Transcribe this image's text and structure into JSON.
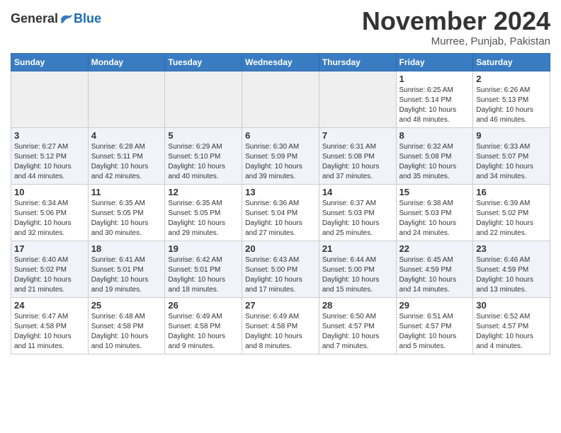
{
  "header": {
    "logo_general": "General",
    "logo_blue": "Blue",
    "month_title": "November 2024",
    "location": "Murree, Punjab, Pakistan"
  },
  "weekdays": [
    "Sunday",
    "Monday",
    "Tuesday",
    "Wednesday",
    "Thursday",
    "Friday",
    "Saturday"
  ],
  "weeks": [
    {
      "row_class": "row-1",
      "days": [
        {
          "num": "",
          "empty": true
        },
        {
          "num": "",
          "empty": true
        },
        {
          "num": "",
          "empty": true
        },
        {
          "num": "",
          "empty": true
        },
        {
          "num": "",
          "empty": true
        },
        {
          "num": "1",
          "info": "Sunrise: 6:25 AM\nSunset: 5:14 PM\nDaylight: 10 hours\nand 48 minutes."
        },
        {
          "num": "2",
          "info": "Sunrise: 6:26 AM\nSunset: 5:13 PM\nDaylight: 10 hours\nand 46 minutes."
        }
      ]
    },
    {
      "row_class": "row-2",
      "days": [
        {
          "num": "3",
          "info": "Sunrise: 6:27 AM\nSunset: 5:12 PM\nDaylight: 10 hours\nand 44 minutes."
        },
        {
          "num": "4",
          "info": "Sunrise: 6:28 AM\nSunset: 5:11 PM\nDaylight: 10 hours\nand 42 minutes."
        },
        {
          "num": "5",
          "info": "Sunrise: 6:29 AM\nSunset: 5:10 PM\nDaylight: 10 hours\nand 40 minutes."
        },
        {
          "num": "6",
          "info": "Sunrise: 6:30 AM\nSunset: 5:09 PM\nDaylight: 10 hours\nand 39 minutes."
        },
        {
          "num": "7",
          "info": "Sunrise: 6:31 AM\nSunset: 5:08 PM\nDaylight: 10 hours\nand 37 minutes."
        },
        {
          "num": "8",
          "info": "Sunrise: 6:32 AM\nSunset: 5:08 PM\nDaylight: 10 hours\nand 35 minutes."
        },
        {
          "num": "9",
          "info": "Sunrise: 6:33 AM\nSunset: 5:07 PM\nDaylight: 10 hours\nand 34 minutes."
        }
      ]
    },
    {
      "row_class": "row-3",
      "days": [
        {
          "num": "10",
          "info": "Sunrise: 6:34 AM\nSunset: 5:06 PM\nDaylight: 10 hours\nand 32 minutes."
        },
        {
          "num": "11",
          "info": "Sunrise: 6:35 AM\nSunset: 5:05 PM\nDaylight: 10 hours\nand 30 minutes."
        },
        {
          "num": "12",
          "info": "Sunrise: 6:35 AM\nSunset: 5:05 PM\nDaylight: 10 hours\nand 29 minutes."
        },
        {
          "num": "13",
          "info": "Sunrise: 6:36 AM\nSunset: 5:04 PM\nDaylight: 10 hours\nand 27 minutes."
        },
        {
          "num": "14",
          "info": "Sunrise: 6:37 AM\nSunset: 5:03 PM\nDaylight: 10 hours\nand 25 minutes."
        },
        {
          "num": "15",
          "info": "Sunrise: 6:38 AM\nSunset: 5:03 PM\nDaylight: 10 hours\nand 24 minutes."
        },
        {
          "num": "16",
          "info": "Sunrise: 6:39 AM\nSunset: 5:02 PM\nDaylight: 10 hours\nand 22 minutes."
        }
      ]
    },
    {
      "row_class": "row-4",
      "days": [
        {
          "num": "17",
          "info": "Sunrise: 6:40 AM\nSunset: 5:02 PM\nDaylight: 10 hours\nand 21 minutes."
        },
        {
          "num": "18",
          "info": "Sunrise: 6:41 AM\nSunset: 5:01 PM\nDaylight: 10 hours\nand 19 minutes."
        },
        {
          "num": "19",
          "info": "Sunrise: 6:42 AM\nSunset: 5:01 PM\nDaylight: 10 hours\nand 18 minutes."
        },
        {
          "num": "20",
          "info": "Sunrise: 6:43 AM\nSunset: 5:00 PM\nDaylight: 10 hours\nand 17 minutes."
        },
        {
          "num": "21",
          "info": "Sunrise: 6:44 AM\nSunset: 5:00 PM\nDaylight: 10 hours\nand 15 minutes."
        },
        {
          "num": "22",
          "info": "Sunrise: 6:45 AM\nSunset: 4:59 PM\nDaylight: 10 hours\nand 14 minutes."
        },
        {
          "num": "23",
          "info": "Sunrise: 6:46 AM\nSunset: 4:59 PM\nDaylight: 10 hours\nand 13 minutes."
        }
      ]
    },
    {
      "row_class": "row-5",
      "days": [
        {
          "num": "24",
          "info": "Sunrise: 6:47 AM\nSunset: 4:58 PM\nDaylight: 10 hours\nand 11 minutes."
        },
        {
          "num": "25",
          "info": "Sunrise: 6:48 AM\nSunset: 4:58 PM\nDaylight: 10 hours\nand 10 minutes."
        },
        {
          "num": "26",
          "info": "Sunrise: 6:49 AM\nSunset: 4:58 PM\nDaylight: 10 hours\nand 9 minutes."
        },
        {
          "num": "27",
          "info": "Sunrise: 6:49 AM\nSunset: 4:58 PM\nDaylight: 10 hours\nand 8 minutes."
        },
        {
          "num": "28",
          "info": "Sunrise: 6:50 AM\nSunset: 4:57 PM\nDaylight: 10 hours\nand 7 minutes."
        },
        {
          "num": "29",
          "info": "Sunrise: 6:51 AM\nSunset: 4:57 PM\nDaylight: 10 hours\nand 5 minutes."
        },
        {
          "num": "30",
          "info": "Sunrise: 6:52 AM\nSunset: 4:57 PM\nDaylight: 10 hours\nand 4 minutes."
        }
      ]
    }
  ]
}
